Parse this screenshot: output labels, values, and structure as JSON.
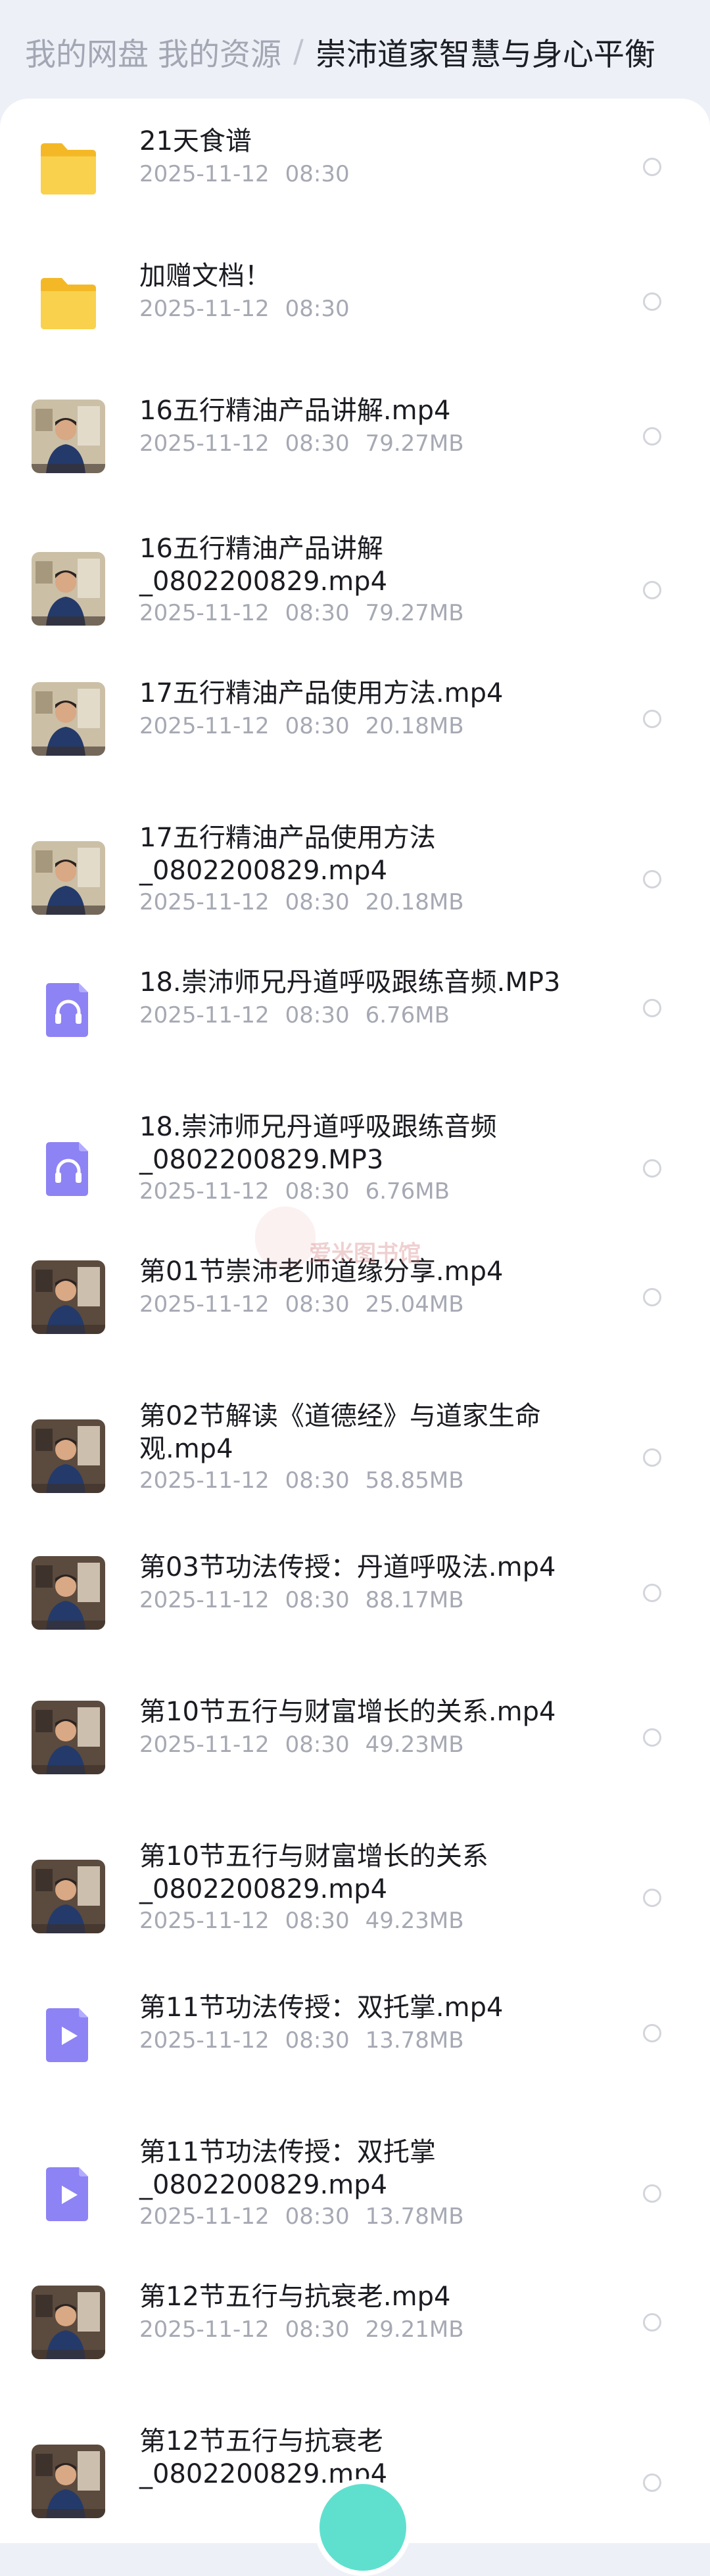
{
  "breadcrumb": {
    "root": "我的网盘",
    "parent": "我的资源",
    "separator": "/",
    "current": "崇沛道家智慧与身心平衡"
  },
  "watermark": "爱米图书馆",
  "colors": {
    "accent": "#8b7ff2",
    "folder": "#f7c948",
    "fab": "#5fe0cf"
  },
  "files": [
    {
      "type": "folder",
      "icon": "folder-icon",
      "title": "21天食谱",
      "date": "2025-11-12",
      "time": "08:30"
    },
    {
      "type": "folder",
      "icon": "folder-icon",
      "title": "加赠文档！",
      "date": "2025-11-12",
      "time": "08:30"
    },
    {
      "type": "video",
      "icon": "video-thumbnail",
      "title": "16五行精油产品讲解.mp4",
      "date": "2025-11-12",
      "time": "08:30",
      "size": "79.27MB"
    },
    {
      "type": "video",
      "icon": "video-thumbnail",
      "title": "16五行精油产品讲解_0802200829.mp4",
      "date": "2025-11-12",
      "time": "08:30",
      "size": "79.27MB"
    },
    {
      "type": "video",
      "icon": "video-thumbnail",
      "title": "17五行精油产品使用方法.mp4",
      "date": "2025-11-12",
      "time": "08:30",
      "size": "20.18MB"
    },
    {
      "type": "video",
      "icon": "video-thumbnail",
      "title": "17五行精油产品使用方法_0802200829.mp4",
      "date": "2025-11-12",
      "time": "08:30",
      "size": "20.18MB"
    },
    {
      "type": "audio",
      "icon": "headphones-icon",
      "title": "18.崇沛师兄丹道呼吸跟练音频.MP3",
      "date": "2025-11-12",
      "time": "08:30",
      "size": "6.76MB"
    },
    {
      "type": "audio",
      "icon": "headphones-icon",
      "title": "18.崇沛师兄丹道呼吸跟练音频_0802200829.MP3",
      "date": "2025-11-12",
      "time": "08:30",
      "size": "6.76MB"
    },
    {
      "type": "video",
      "icon": "video-thumbnail",
      "title": "第01节崇沛老师道缘分享.mp4",
      "date": "2025-11-12",
      "time": "08:30",
      "size": "25.04MB"
    },
    {
      "type": "video",
      "icon": "video-thumbnail",
      "title": "第02节解读《道德经》与道家生命观.mp4",
      "date": "2025-11-12",
      "time": "08:30",
      "size": "58.85MB"
    },
    {
      "type": "video",
      "icon": "video-thumbnail",
      "title": "第03节功法传授：丹道呼吸法.mp4",
      "date": "2025-11-12",
      "time": "08:30",
      "size": "88.17MB"
    },
    {
      "type": "video",
      "icon": "video-thumbnail",
      "title": "第10节五行与财富增长的关系.mp4",
      "date": "2025-11-12",
      "time": "08:30",
      "size": "49.23MB"
    },
    {
      "type": "video",
      "icon": "video-thumbnail",
      "title": "第10节五行与财富增长的关系_0802200829.mp4",
      "date": "2025-11-12",
      "time": "08:30",
      "size": "49.23MB"
    },
    {
      "type": "video-generic",
      "icon": "play-icon",
      "title": "第11节功法传授：双托掌.mp4",
      "date": "2025-11-12",
      "time": "08:30",
      "size": "13.78MB"
    },
    {
      "type": "video-generic",
      "icon": "play-icon",
      "title": "第11节功法传授：双托掌_0802200829.mp4",
      "date": "2025-11-12",
      "time": "08:30",
      "size": "13.78MB"
    },
    {
      "type": "video",
      "icon": "video-thumbnail",
      "title": "第12节五行与抗衰老.mp4",
      "date": "2025-11-12",
      "time": "08:30",
      "size": "29.21MB"
    },
    {
      "type": "video",
      "icon": "video-thumbnail",
      "title": "第12节五行与抗衰老_0802200829.mp4",
      "date": "",
      "time": "",
      "size": ""
    }
  ]
}
